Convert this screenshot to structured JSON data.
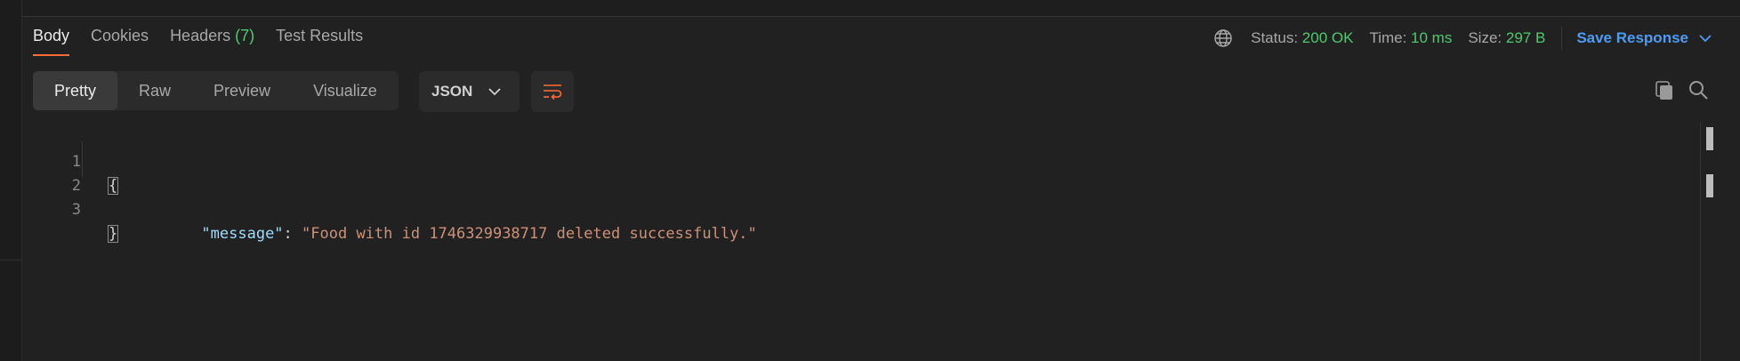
{
  "tabs": [
    {
      "label": "Body",
      "active": true
    },
    {
      "label": "Cookies"
    },
    {
      "label": "Headers",
      "count": "(7)"
    },
    {
      "label": "Test Results"
    }
  ],
  "status": {
    "status_label": "Status:",
    "status_value": "200 OK",
    "time_label": "Time:",
    "time_value": "10 ms",
    "size_label": "Size:",
    "size_value": "297 B",
    "save_response": "Save Response"
  },
  "view_modes": [
    "Pretty",
    "Raw",
    "Preview",
    "Visualize"
  ],
  "active_view": "Pretty",
  "format": "JSON",
  "editor": {
    "line_numbers": [
      "1",
      "2",
      "3"
    ],
    "open_brace": "{",
    "close_brace": "}",
    "key": "\"message\"",
    "colon": ": ",
    "value": "\"Food with id 1746329938717 deleted successfully.\""
  },
  "colors": {
    "accent": "#ff6c37",
    "success": "#4ec96f",
    "link": "#4c9cf5",
    "json_key": "#9cdcfe",
    "json_string": "#ce9178"
  },
  "icons": [
    "globe-icon",
    "chevron-down-icon",
    "wrap-lines-icon",
    "copy-icon",
    "search-icon"
  ]
}
